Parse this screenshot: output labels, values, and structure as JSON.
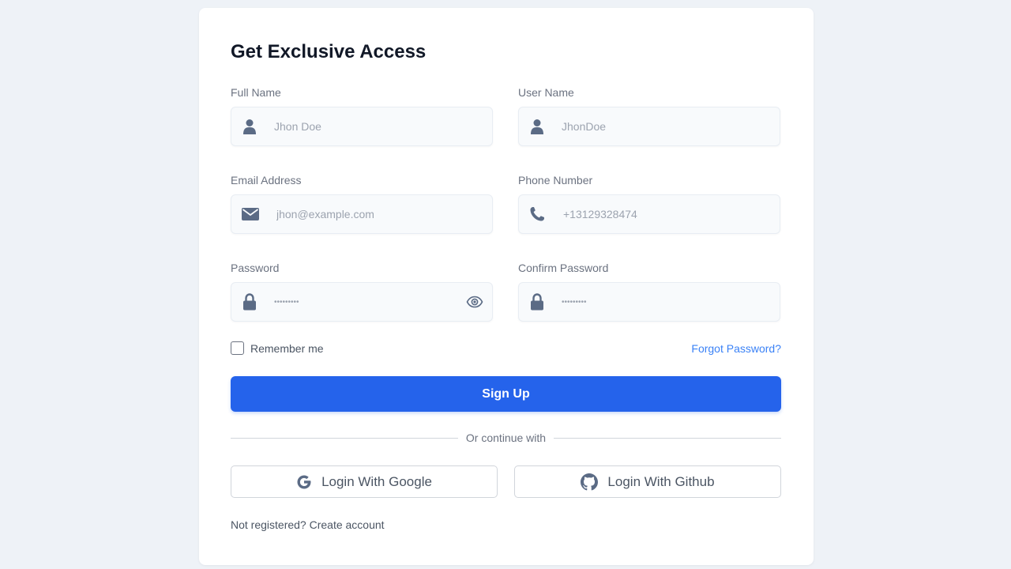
{
  "form": {
    "title": "Get Exclusive Access",
    "fields": [
      {
        "label": "Full Name",
        "placeholder": "Jhon Doe",
        "icon": "user-icon"
      },
      {
        "label": "User Name",
        "placeholder": "JhonDoe",
        "icon": "user-icon"
      },
      {
        "label": "Email Address",
        "placeholder": "jhon@example.com",
        "icon": "envelope-icon"
      },
      {
        "label": "Phone Number",
        "placeholder": "+13129328474",
        "icon": "phone-icon"
      },
      {
        "label": "Password",
        "placeholder": "•••••••••",
        "icon": "lock-icon"
      },
      {
        "label": "Confirm Password",
        "placeholder": "•••••••••",
        "icon": "lock-icon"
      }
    ],
    "remember_label": "Remember me",
    "forgot_label": "Forgot Password?",
    "submit_label": "Sign Up",
    "divider_label": "Or continue with",
    "google_label": "Login With Google",
    "github_label": "Login With Github",
    "not_registered": "Not registered?",
    "create_account": "Create account"
  },
  "colors": {
    "background": "#eef2f7",
    "primary": "#2563eb",
    "link": "#3b82f6",
    "icon": "#5b6b85"
  }
}
